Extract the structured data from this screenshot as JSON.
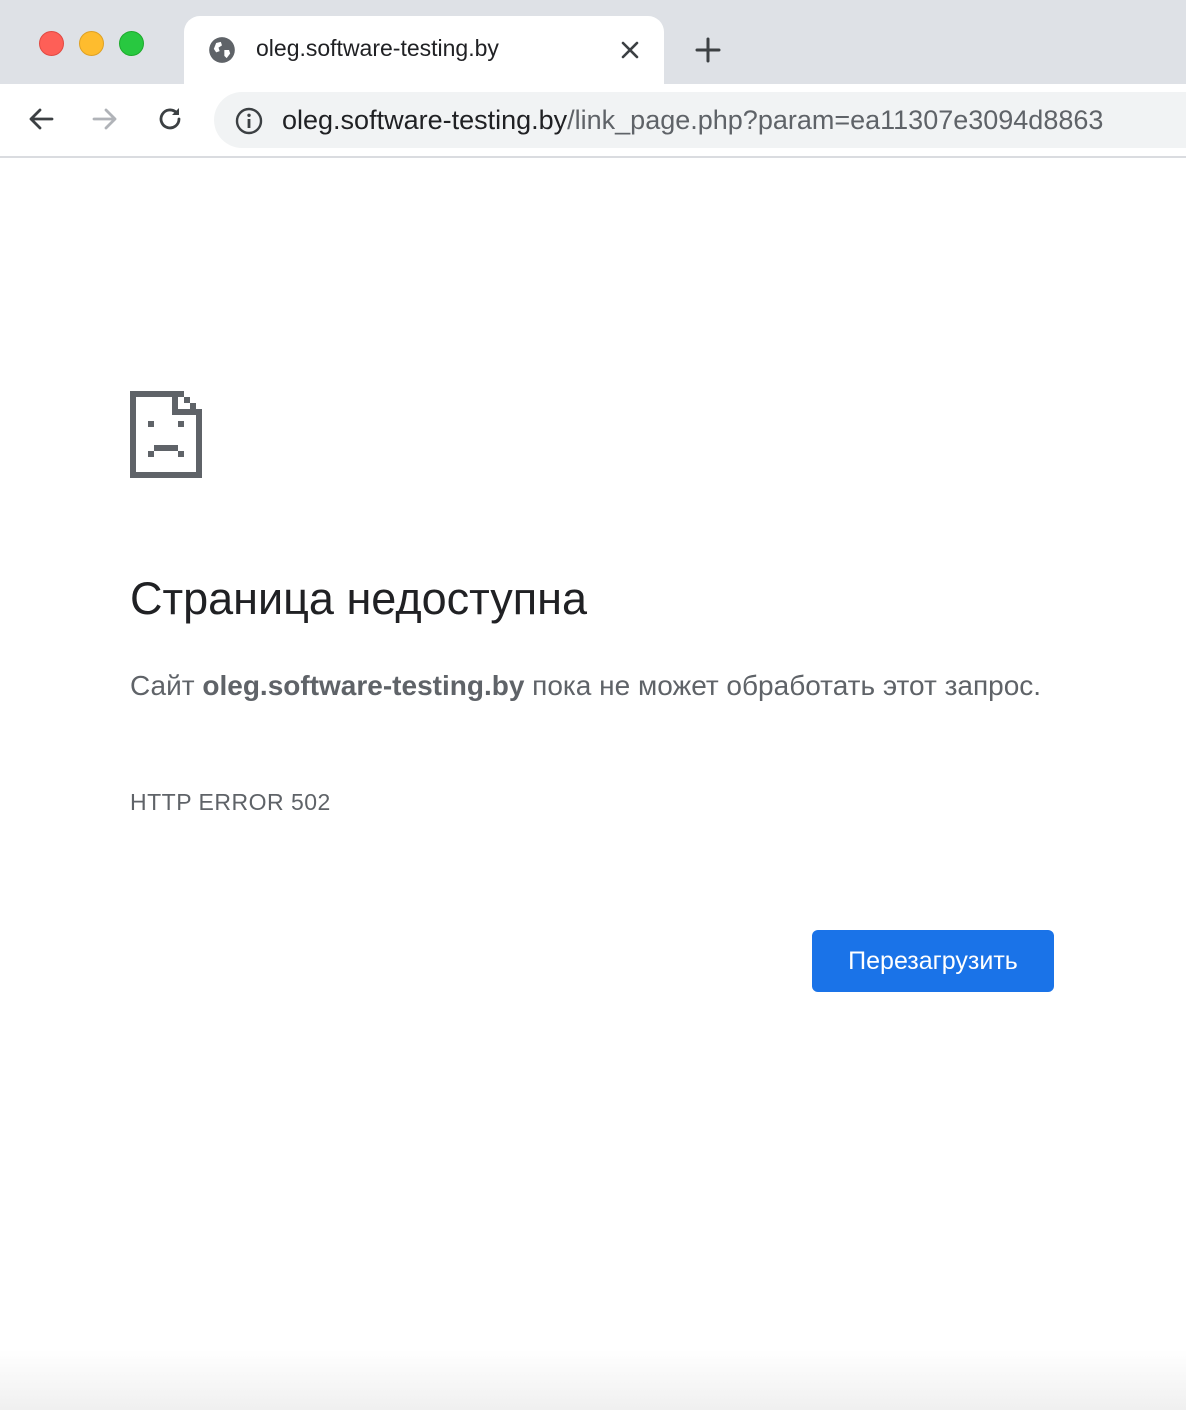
{
  "window": {
    "traffic_lights": [
      "close",
      "minimize",
      "maximize"
    ]
  },
  "tab": {
    "title": "oleg.software-testing.by",
    "favicon": "globe-icon"
  },
  "toolbar": {
    "url_host": "oleg.software-testing.by",
    "url_path": "/link_page.php?param=ea11307e3094d8863"
  },
  "error_page": {
    "headline": "Страница недоступна",
    "desc_prefix": "Сайт ",
    "desc_host": "oleg.software-testing.by",
    "desc_suffix": " пока не может обработать этот запрос.",
    "error_code": "HTTP ERROR 502",
    "reload_label": "Перезагрузить"
  },
  "colors": {
    "accent": "#1a73e8",
    "tabstrip": "#dee1e6",
    "text_primary": "#202124",
    "text_secondary": "#5f6368"
  }
}
